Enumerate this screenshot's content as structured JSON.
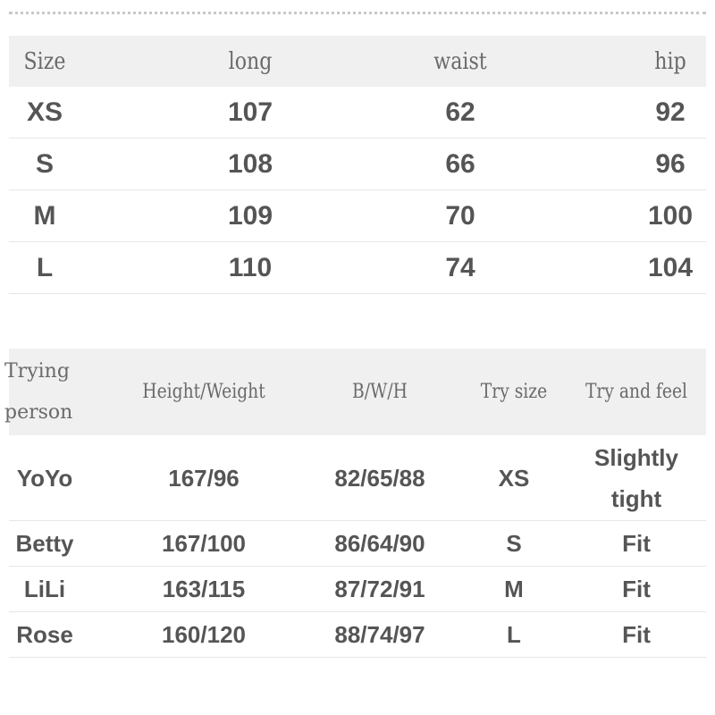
{
  "size_table": {
    "headers": [
      "Size",
      "long",
      "waist",
      "hip"
    ],
    "rows": [
      [
        "XS",
        "107",
        "62",
        "92"
      ],
      [
        "S",
        "108",
        "66",
        "96"
      ],
      [
        "M",
        "109",
        "70",
        "100"
      ],
      [
        "L",
        "110",
        "74",
        "104"
      ]
    ]
  },
  "try_table": {
    "headers": [
      "Trying person",
      "Height/Weight",
      "B/W/H",
      "Try size",
      "Try and feel"
    ],
    "rows": [
      [
        "YoYo",
        "167/96",
        "82/65/88",
        "XS",
        "Slightly tight"
      ],
      [
        "Betty",
        "167/100",
        "86/64/90",
        "S",
        "Fit"
      ],
      [
        "LiLi",
        "163/115",
        "87/72/91",
        "M",
        "Fit"
      ],
      [
        "Rose",
        "160/120",
        "88/74/97",
        "L",
        "Fit"
      ]
    ]
  }
}
